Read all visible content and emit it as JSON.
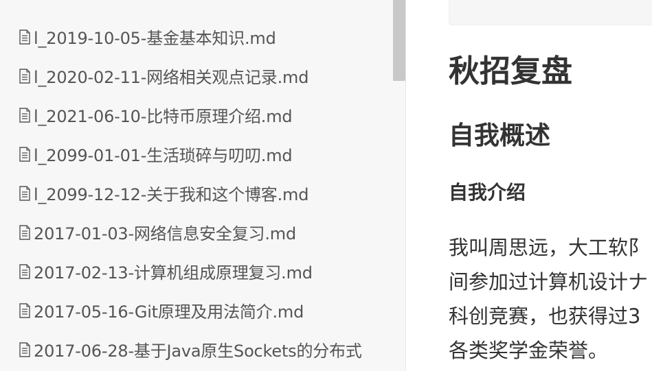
{
  "sidebar": {
    "files": [
      {
        "name": "l_2019-10-05-基金基本知识.md",
        "icon": "file-icon"
      },
      {
        "name": "l_2020-02-11-网络相关观点记录.md",
        "icon": "file-icon"
      },
      {
        "name": "l_2021-06-10-比特币原理介绍.md",
        "icon": "file-icon"
      },
      {
        "name": "l_2099-01-01-生活琐碎与叨叨.md",
        "icon": "file-icon"
      },
      {
        "name": "l_2099-12-12-关于我和这个博客.md",
        "icon": "file-icon"
      },
      {
        "name": "2017-01-03-网络信息安全复习.md",
        "icon": "file-icon"
      },
      {
        "name": "2017-02-13-计算机组成原理复习.md",
        "icon": "file-icon"
      },
      {
        "name": "2017-05-16-Git原理及用法简介.md",
        "icon": "file-icon"
      },
      {
        "name": "2017-06-28-基于Java原生Sockets的分布式",
        "icon": "file-icon"
      }
    ]
  },
  "editor": {
    "h1": "秋招复盘",
    "h2": "自我概述",
    "h3": "自我介绍",
    "paragraph_lines": [
      "我叫周思远，大工软阝",
      "间参加过计算机设计ナ",
      "科创竞赛，也获得过3",
      "各类奖学金荣誉。"
    ]
  },
  "colors": {
    "sidebar_bg": "#f7f7f7",
    "sidebar_text": "#555555",
    "heading_text": "#333333",
    "scrollbar_thumb": "#c8c8c8"
  }
}
